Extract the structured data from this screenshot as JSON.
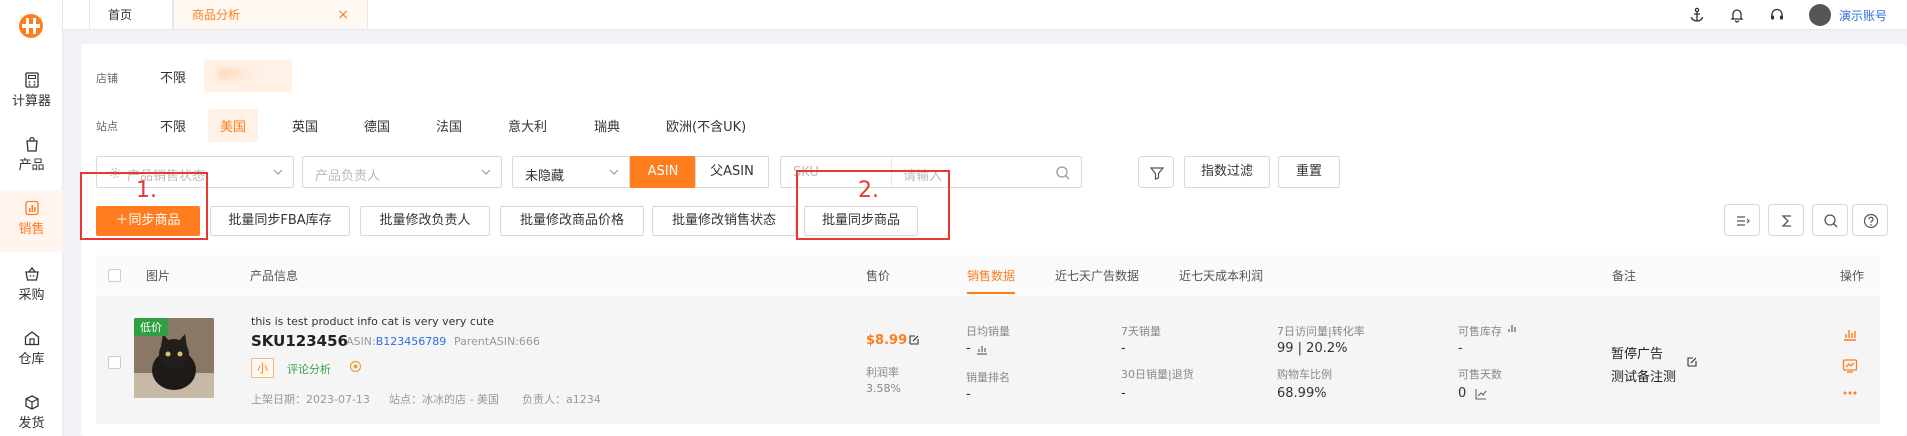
{
  "colors": {
    "accent": "#ff7d1f",
    "link": "#2f6fe0",
    "annotation": "#e53935",
    "badge_green": "#2ea043"
  },
  "sidebar": {
    "items": [
      {
        "label": "计算器",
        "icon": "calculator-icon"
      },
      {
        "label": "产品",
        "icon": "bag-icon"
      },
      {
        "label": "销售",
        "icon": "chart-icon",
        "active": true
      },
      {
        "label": "采购",
        "icon": "basket-icon"
      },
      {
        "label": "仓库",
        "icon": "warehouse-icon"
      },
      {
        "label": "发货",
        "icon": "box-icon"
      }
    ]
  },
  "tabs": [
    {
      "label": "首页"
    },
    {
      "label": "商品分析",
      "active": true,
      "close": "×"
    }
  ],
  "header": {
    "account": "演示账号"
  },
  "filters": {
    "store": {
      "label": "店铺",
      "options": [
        "不限"
      ]
    },
    "site": {
      "label": "站点",
      "options": [
        "不限",
        "美国",
        "英国",
        "德国",
        "法国",
        "意大利",
        "瑞典",
        "欧洲(不含UK)"
      ],
      "selected": "美国"
    },
    "status_select": {
      "placeholder": "产品销售状态"
    },
    "owner_select": {
      "placeholder": "产品负责人"
    },
    "hidden_select": {
      "value": "未隐藏"
    },
    "asin_toggle": {
      "options": [
        "ASIN",
        "父ASIN"
      ],
      "selected": "ASIN"
    },
    "search": {
      "field": "SKU",
      "placeholder": "请输入"
    },
    "metric_filter": "指数过滤",
    "reset": "重置"
  },
  "actions": {
    "sync": "＋同步商品",
    "batch_fba": "批量同步FBA库存",
    "batch_owner": "批量修改负责人",
    "batch_price": "批量修改商品价格",
    "batch_status": "批量修改销售状态",
    "batch_sync": "批量同步商品"
  },
  "annotations": [
    "1.",
    "2."
  ],
  "table": {
    "headers": {
      "image": "图片",
      "info": "产品信息",
      "price": "售价",
      "tabs": [
        "销售数据",
        "近七天广告数据",
        "近七天成本利润"
      ],
      "note": "备注",
      "ops": "操作"
    },
    "rows": [
      {
        "badge": "低价",
        "name": "this is test product info cat is very very cute",
        "sku": "SKU123456",
        "asin_label": "ASIN:",
        "asin": "B123456789",
        "parent_asin": "ParentASIN:666",
        "size_tag": "小",
        "review": "评论分析",
        "listed": "上架日期：2023-07-13",
        "site": "站点：冰冰的店 - 美国",
        "owner": "负责人：a1234",
        "price": "$8.99",
        "margin_label": "利润率",
        "margin": "3.58%",
        "metrics": {
          "daily_sales_label": "日均销量",
          "daily_sales": "-",
          "sales_rank_label": "销量排名",
          "sales_rank": "-",
          "sales_7d_label": "7天销量",
          "sales_7d": "-",
          "sales_30d_label": "30日销量|退货",
          "sales_30d": "-",
          "visits_label": "7日访问量|转化率",
          "visits": "99 | 20.2%",
          "cart_label": "购物车比例",
          "cart": "68.99%",
          "stock_label": "可售库存",
          "stock": "-",
          "days_label": "可售天数",
          "days": "0"
        },
        "note": "暂停广告",
        "note2": "测试备注测"
      }
    ]
  }
}
